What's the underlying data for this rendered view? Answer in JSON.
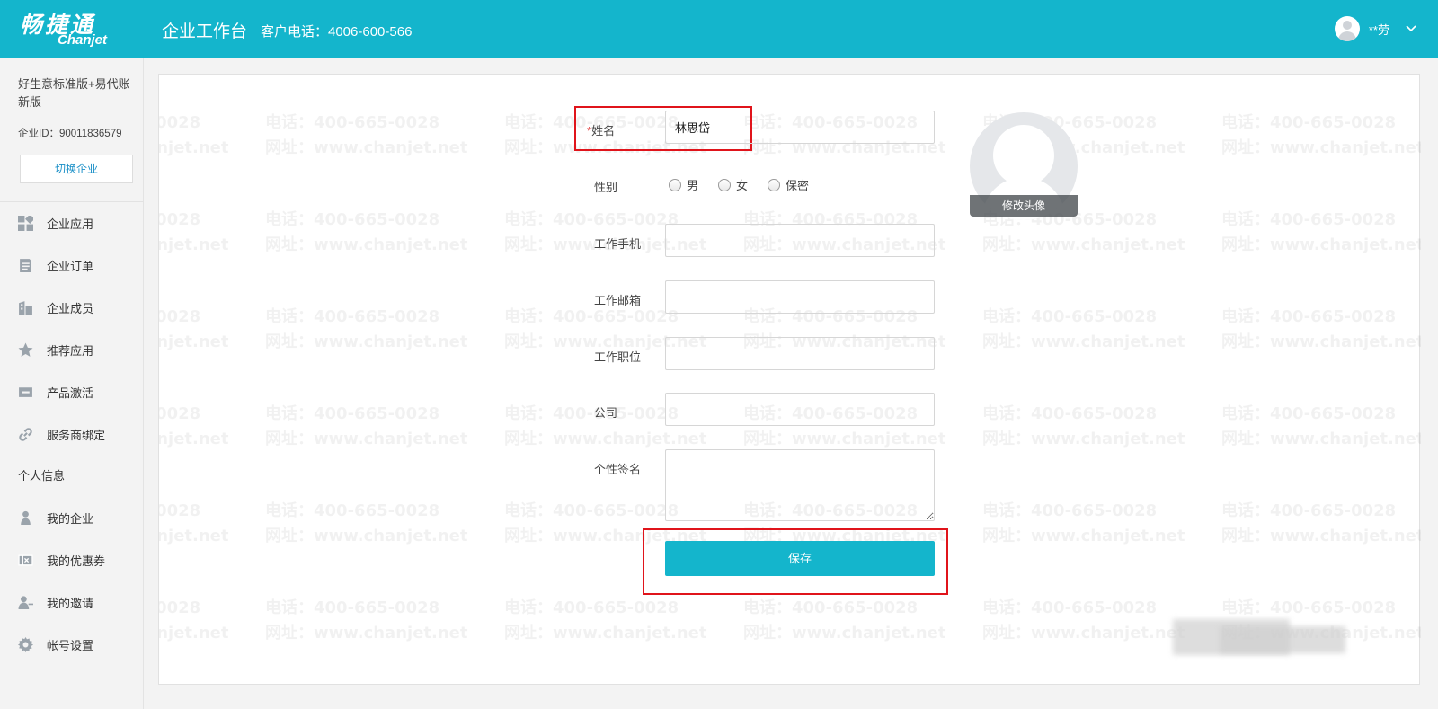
{
  "header": {
    "logo_cn": "畅捷通",
    "logo_en": "Chanjet",
    "workbench": "企业工作台",
    "hotline": "客户电话：4006-600-566",
    "username": "**劳",
    "bg_color": "#14b5cc"
  },
  "sidebar": {
    "company_name": "好生意标准版+易代账新版",
    "company_id": "企业ID：90011836579",
    "switch_label": "切换企业",
    "items": [
      {
        "label": "企业应用",
        "icon": "apps-grid-icon"
      },
      {
        "label": "企业订单",
        "icon": "order-document-icon"
      },
      {
        "label": "企业成员",
        "icon": "building-icon"
      },
      {
        "label": "推荐应用",
        "icon": "star-icon"
      },
      {
        "label": "产品激活",
        "icon": "activation-card-icon"
      },
      {
        "label": "服务商绑定",
        "icon": "link-icon"
      }
    ],
    "section_personal": "个人信息",
    "personal_items": [
      {
        "label": "我的企业",
        "icon": "person-icon"
      },
      {
        "label": "我的优惠券",
        "icon": "coupon-icon"
      },
      {
        "label": "我的邀请",
        "icon": "invite-user-icon"
      },
      {
        "label": "帐号设置",
        "icon": "gear-icon"
      }
    ]
  },
  "form": {
    "name_required": "*",
    "name_label": "姓名",
    "name_value": "林思岱",
    "gender_label": "性别",
    "gender_options": [
      "男",
      "女",
      "保密"
    ],
    "phone_label": "工作手机",
    "phone_value": "",
    "email_label": "工作邮箱",
    "email_value": "",
    "position_label": "工作职位",
    "position_value": "",
    "company_label": "公司",
    "company_value": "",
    "signature_label": "个性签名",
    "signature_value": "",
    "save_label": "保存",
    "change_avatar": "修改头像"
  },
  "watermark": {
    "phone": "电话：400-665-0028",
    "site": "网址：www.chanjet.net"
  }
}
